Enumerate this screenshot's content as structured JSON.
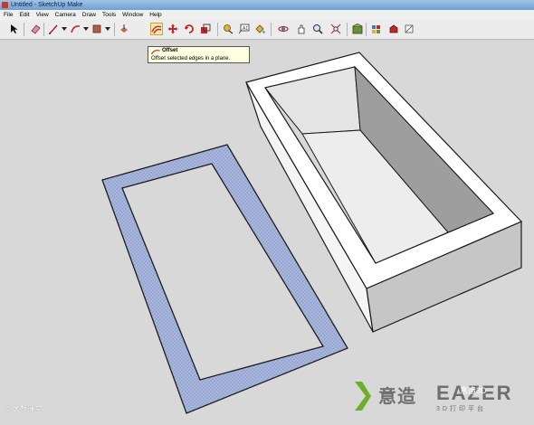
{
  "window": {
    "title": "Untitled - SketchUp Make"
  },
  "menu": {
    "items": [
      "File",
      "Edit",
      "View",
      "Camera",
      "Draw",
      "Tools",
      "Window",
      "Help"
    ]
  },
  "toolbar": {
    "tools": [
      "select-icon",
      "eraser-icon",
      "line-icon",
      "arc-icon",
      "rectangle-icon",
      "push-pull-icon",
      "offset-icon",
      "move-icon",
      "rotate-icon",
      "scale-icon",
      "tape-measure-icon",
      "text-icon",
      "paint-bucket-icon",
      "orbit-icon",
      "pan-icon",
      "zoom-icon",
      "zoom-extents-icon",
      "3d-warehouse-icon",
      "components-icon",
      "extension-icon"
    ],
    "selected_tool": "offset"
  },
  "tooltip": {
    "title": "Offset",
    "description": "Offset selected edges in a plane."
  },
  "watermarks": {
    "left": "© 大数课堂",
    "right_zh": "意造",
    "right_en": "EAZER",
    "right_sub": "3D打印平台",
    "right_badge": "意造3D"
  },
  "colors": {
    "viewport_bg": "#d8d8d8",
    "offset_face": "#a7b4d9",
    "box_face_light": "#ffffff",
    "box_face_shade": "#c9c9c9",
    "accent_logo": "#6fae2a"
  }
}
